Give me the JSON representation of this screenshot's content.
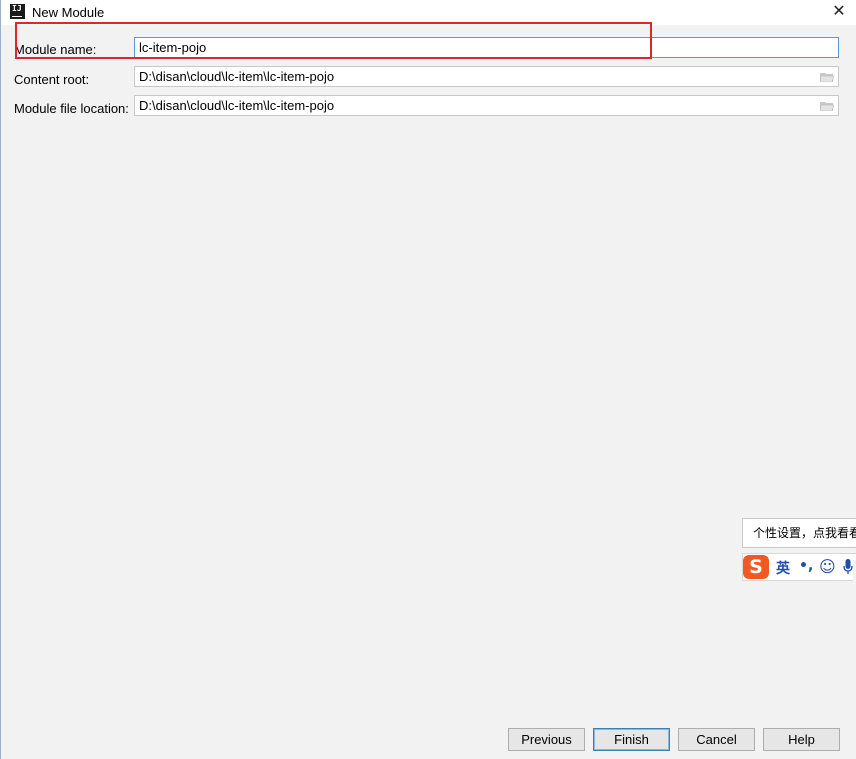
{
  "window": {
    "title": "New Module",
    "app_icon_text": "IJ"
  },
  "form": {
    "module_name_label": "Module name:",
    "module_name_value": "lc-item-pojo",
    "content_root_label": "Content root:",
    "content_root_value": "D:\\disan\\cloud\\lc-item\\lc-item-pojo",
    "module_file_location_label": "Module file location:",
    "module_file_location_value": "D:\\disan\\cloud\\lc-item\\lc-item-pojo"
  },
  "ime": {
    "tooltip": "个性设置，点我看看",
    "logo": "S",
    "lang": "英",
    "punct": "•,",
    "emoji": "☺",
    "mic": "🎤"
  },
  "buttons": {
    "previous": "Previous",
    "finish": "Finish",
    "cancel": "Cancel",
    "help": "Help"
  },
  "colors": {
    "highlight_box": "#e0262a",
    "focus_border": "#5a9bd5"
  }
}
